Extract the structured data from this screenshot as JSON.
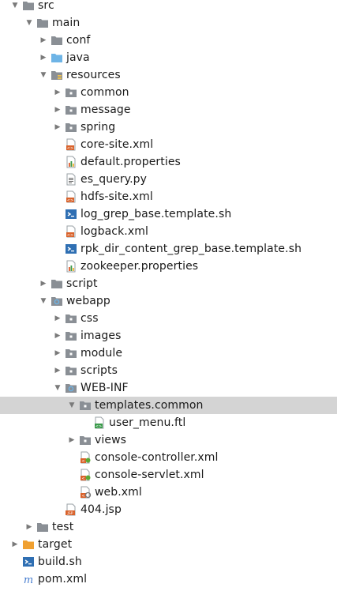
{
  "project_tree": {
    "rows": [
      {
        "label": "src",
        "icon": "folder-icon",
        "expanded": true,
        "level": 1
      },
      {
        "label": "main",
        "icon": "folder-icon",
        "expanded": true,
        "level": 2
      },
      {
        "label": "conf",
        "icon": "folder-icon",
        "expanded": false,
        "level": 3
      },
      {
        "label": "java",
        "icon": "source-folder-icon",
        "expanded": false,
        "level": 3
      },
      {
        "label": "resources",
        "icon": "resources-folder-icon",
        "expanded": true,
        "level": 3
      },
      {
        "label": "common",
        "icon": "package-icon",
        "expanded": false,
        "level": 4
      },
      {
        "label": "message",
        "icon": "package-icon",
        "expanded": false,
        "level": 4
      },
      {
        "label": "spring",
        "icon": "package-icon",
        "expanded": false,
        "level": 4
      },
      {
        "label": "core-site.xml",
        "icon": "xml-file-icon",
        "level": 4
      },
      {
        "label": "default.properties",
        "icon": "properties-file-icon",
        "level": 4
      },
      {
        "label": "es_query.py",
        "icon": "text-file-icon",
        "level": 4
      },
      {
        "label": "hdfs-site.xml",
        "icon": "xml-file-icon",
        "level": 4
      },
      {
        "label": "log_grep_base.template.sh",
        "icon": "shell-script-icon",
        "level": 4
      },
      {
        "label": "logback.xml",
        "icon": "xml-file-icon",
        "level": 4
      },
      {
        "label": "rpk_dir_content_grep_base.template.sh",
        "icon": "shell-script-icon",
        "level": 4
      },
      {
        "label": "zookeeper.properties",
        "icon": "properties-file-icon",
        "level": 4
      },
      {
        "label": "script",
        "icon": "folder-icon",
        "expanded": false,
        "level": 3
      },
      {
        "label": "webapp",
        "icon": "web-folder-icon",
        "expanded": true,
        "level": 3
      },
      {
        "label": "css",
        "icon": "package-icon",
        "expanded": false,
        "level": 4
      },
      {
        "label": "images",
        "icon": "package-icon",
        "expanded": false,
        "level": 4
      },
      {
        "label": "module",
        "icon": "package-icon",
        "expanded": false,
        "level": 4
      },
      {
        "label": "scripts",
        "icon": "package-icon",
        "expanded": false,
        "level": 4
      },
      {
        "label": "WEB-INF",
        "icon": "web-inf-folder-icon",
        "expanded": true,
        "level": 4
      },
      {
        "label": "templates.common",
        "icon": "package-icon",
        "expanded": true,
        "level": 5,
        "selected": true
      },
      {
        "label": "user_menu.ftl",
        "icon": "ftl-file-icon",
        "level": 6
      },
      {
        "label": "views",
        "icon": "package-icon",
        "expanded": false,
        "level": 5
      },
      {
        "label": "console-controller.xml",
        "icon": "spring-xml-icon",
        "level": 5
      },
      {
        "label": "console-servlet.xml",
        "icon": "spring-xml-icon",
        "level": 5
      },
      {
        "label": "web.xml",
        "icon": "web-xml-icon",
        "level": 5
      },
      {
        "label": "404.jsp",
        "icon": "jsp-file-icon",
        "level": 4
      },
      {
        "label": "test",
        "icon": "folder-icon",
        "expanded": false,
        "level": 2
      },
      {
        "label": "target",
        "icon": "excluded-folder-icon",
        "expanded": false,
        "level": 1
      },
      {
        "label": "build.sh",
        "icon": "shell-script-icon",
        "level": 1
      },
      {
        "label": "pom.xml",
        "icon": "maven-icon",
        "level": 1
      }
    ]
  },
  "colors": {
    "selection": "#d4d4d4",
    "folder": "#8a8f95",
    "source_folder": "#6eb4e6",
    "excluded_folder": "#f0a030",
    "xml_badge": "#d9622b",
    "script_blue": "#2f6fb3",
    "maven_blue": "#4a7fd0",
    "ftl_green": "#3a9a4a"
  }
}
